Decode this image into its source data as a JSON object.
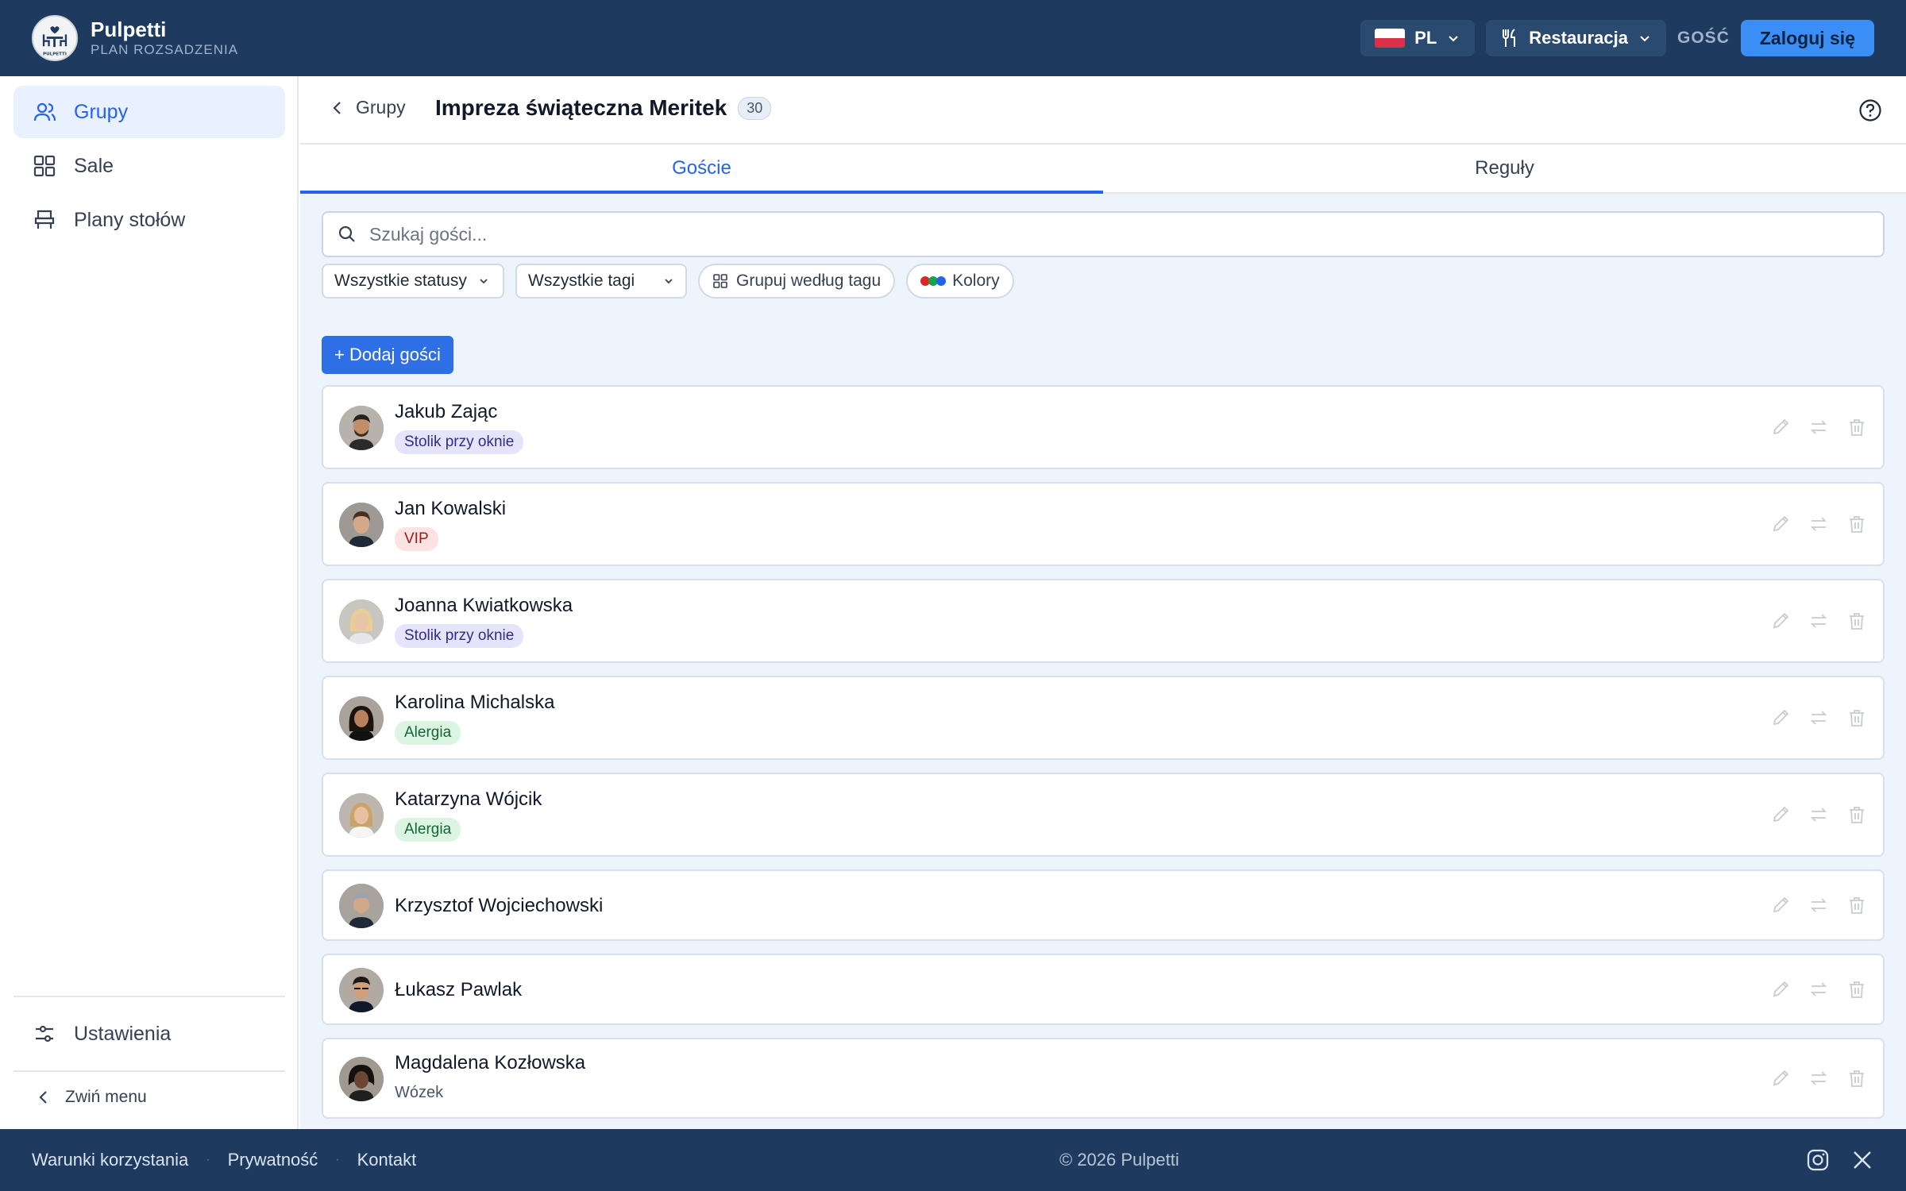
{
  "brand": {
    "name": "Pulpetti",
    "subtitle": "PLAN ROZSADZENIA",
    "logo_text": "PULPETTI"
  },
  "topbar": {
    "language": "PL",
    "venue_type": "Restauracja",
    "role": "GOŚĆ",
    "login_label": "Zaloguj się",
    "colors": {
      "bar": "#1e3a5f",
      "login": "#3b8ef5"
    }
  },
  "sidebar": {
    "items": [
      {
        "label": "Grupy",
        "icon": "users-icon",
        "active": true
      },
      {
        "label": "Sale",
        "icon": "grid-icon",
        "active": false
      },
      {
        "label": "Plany stołów",
        "icon": "chair-icon",
        "active": false
      }
    ],
    "settings_label": "Ustawienia",
    "collapse_label": "Zwiń menu"
  },
  "header": {
    "back_label": "Grupy",
    "title": "Impreza świąteczna Meritek",
    "guest_count": "30"
  },
  "tabs": [
    {
      "label": "Goście",
      "active": true
    },
    {
      "label": "Reguły",
      "active": false
    }
  ],
  "search": {
    "placeholder": "Szukaj gości...",
    "value": ""
  },
  "filters": {
    "status": "Wszystkie statusy",
    "tags": "Wszystkie tagi",
    "group_by": "Grupuj według tagu",
    "colors": "Kolory"
  },
  "add_button": "+ Dodaj gości",
  "guests": [
    {
      "name": "Jakub Zając",
      "tag": "Stolik przy oknie",
      "tag_kind": "window"
    },
    {
      "name": "Jan Kowalski",
      "tag": "VIP",
      "tag_kind": "vip"
    },
    {
      "name": "Joanna Kwiatkowska",
      "tag": "Stolik przy oknie",
      "tag_kind": "window"
    },
    {
      "name": "Karolina Michalska",
      "tag": "Alergia",
      "tag_kind": "allergy"
    },
    {
      "name": "Katarzyna Wójcik",
      "tag": "Alergia",
      "tag_kind": "allergy"
    },
    {
      "name": "Krzysztof Wojciechowski",
      "tag": "",
      "tag_kind": ""
    },
    {
      "name": "Łukasz Pawlak",
      "tag": "",
      "tag_kind": ""
    },
    {
      "name": "Magdalena Kozłowska",
      "note": "Wózek",
      "tag_kind": ""
    }
  ],
  "footer": {
    "links": [
      "Warunki korzystania",
      "Prywatność",
      "Kontakt"
    ],
    "copyright": "© 2026 Pulpetti",
    "social": [
      "instagram-icon",
      "x-icon"
    ]
  }
}
